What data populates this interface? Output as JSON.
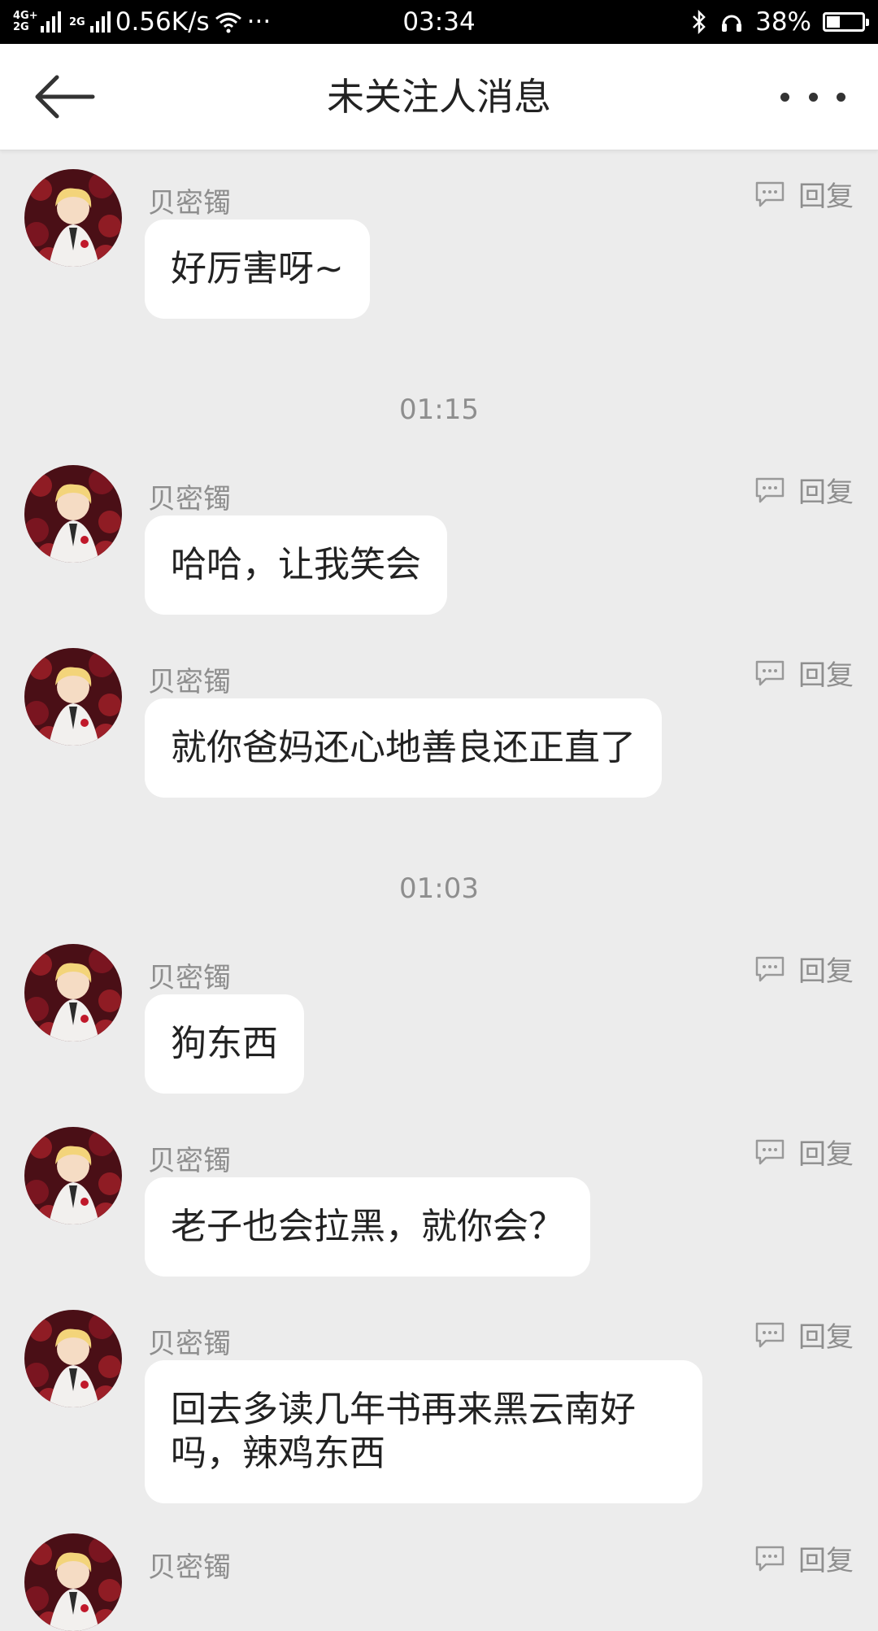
{
  "status_bar": {
    "network_top": "4G+",
    "network_bottom": "2G",
    "network2": "2G",
    "speed": "0.56K/s",
    "overflow": "···",
    "time": "03:34",
    "battery_percent": "38%",
    "battery_level": 0.38
  },
  "header": {
    "title": "未关注人消息",
    "back_icon": "arrow-left-icon",
    "more_icon": "more-dots-icon"
  },
  "reply_label": "回复",
  "timestamps": [
    "01:15",
    "01:03"
  ],
  "messages": [
    {
      "sender": "贝密镯",
      "text": "好厉害呀~"
    },
    {
      "sender": "贝密镯",
      "text": "哈哈，让我笑会"
    },
    {
      "sender": "贝密镯",
      "text": "就你爸妈还心地善良还正直了"
    },
    {
      "sender": "贝密镯",
      "text": "狗东西"
    },
    {
      "sender": "贝密镯",
      "text": "老子也会拉黑，就你会？"
    },
    {
      "sender": "贝密镯",
      "text": "回去多读几年书再来黑云南好吗，辣鸡东西"
    },
    {
      "sender": "贝密镯",
      "text": ""
    }
  ],
  "colors": {
    "background": "#ececec",
    "bubble": "#ffffff",
    "muted": "#8e8e8e"
  }
}
